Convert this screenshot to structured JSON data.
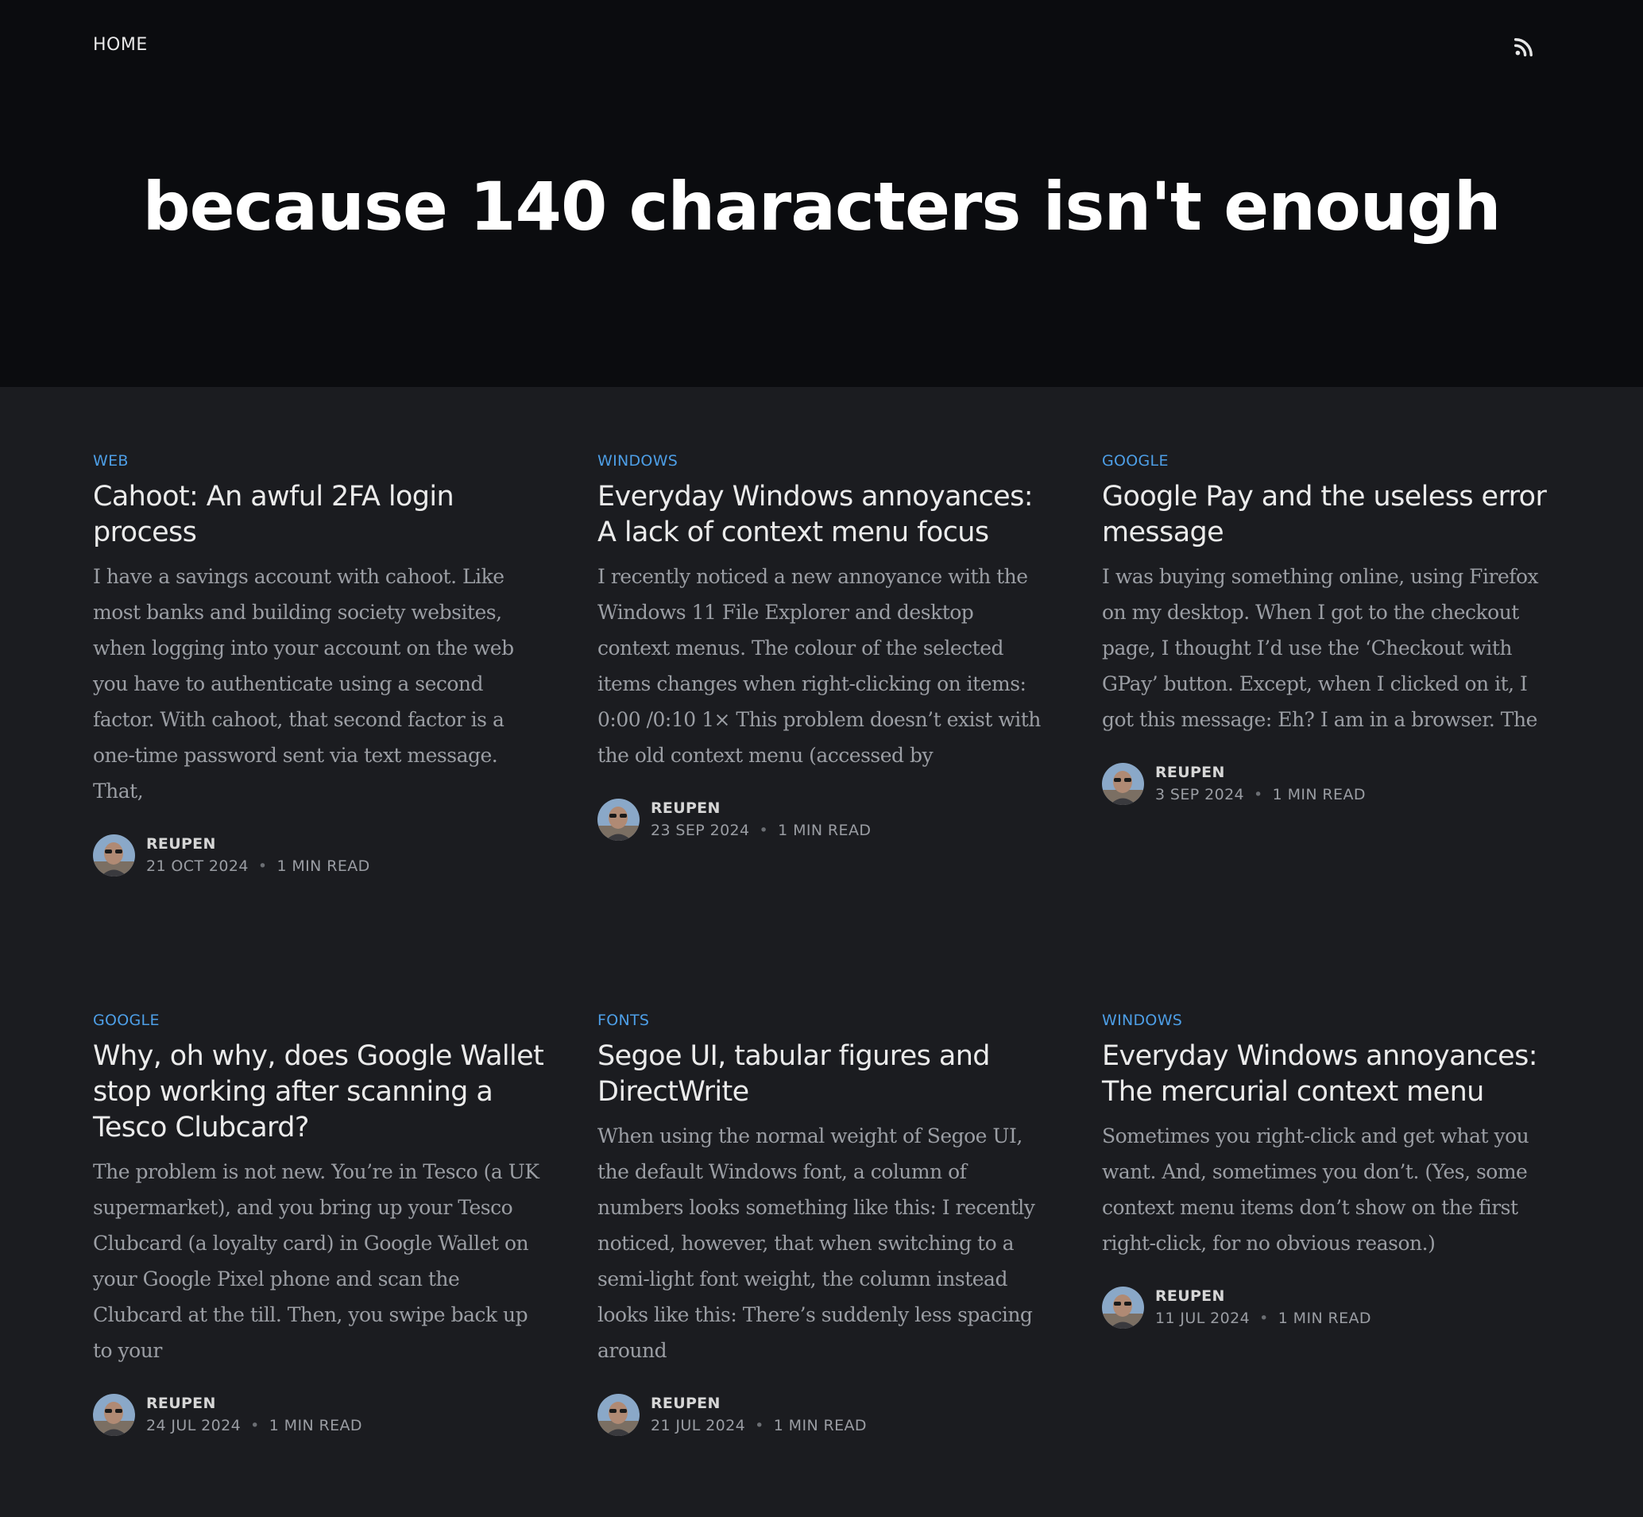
{
  "nav": {
    "home_label": "HOME"
  },
  "header": {
    "title": "because 140 characters isn't enough"
  },
  "posts": [
    {
      "tag": "WEB",
      "title": "Cahoot: An awful 2FA login process",
      "excerpt": "I have a savings account with cahoot. Like most banks and building society websites, when logging into your account on the web you have to authenticate using a second factor. With cahoot, that second factor is a one-time password sent via text message. That,",
      "author": "REUPEN",
      "date": "21 OCT 2024",
      "read_time": "1 MIN READ"
    },
    {
      "tag": "WINDOWS",
      "title": "Everyday Windows annoyances: A lack of context menu focus",
      "excerpt": "I recently noticed a new annoyance with the Windows 11 File Explorer and desktop context menus. The colour of the selected items changes when right-clicking on items: 0:00 /0:10 1× This problem doesn’t exist with the old context menu (accessed by",
      "author": "REUPEN",
      "date": "23 SEP 2024",
      "read_time": "1 MIN READ"
    },
    {
      "tag": "GOOGLE",
      "title": "Google Pay and the useless error message",
      "excerpt": "I was buying something online, using Firefox on my desktop. When I got to the checkout page, I thought I’d use the ‘Checkout with GPay’ button. Except, when I clicked on it, I got this message: Eh? I am in a browser. The",
      "author": "REUPEN",
      "date": "3 SEP 2024",
      "read_time": "1 MIN READ"
    },
    {
      "tag": "GOOGLE",
      "title": "Why, oh why, does Google Wallet stop working after scanning a Tesco Clubcard?",
      "excerpt": "The problem is not new. You’re in Tesco (a UK supermarket), and you bring up your Tesco Clubcard (a loyalty card) in Google Wallet on your Google Pixel phone and scan the Clubcard at the till. Then, you swipe back up to your",
      "author": "REUPEN",
      "date": "24 JUL 2024",
      "read_time": "1 MIN READ"
    },
    {
      "tag": "FONTS",
      "title": "Segoe UI, tabular figures and DirectWrite",
      "excerpt": "When using the normal weight of Segoe UI, the default Windows font, a column of numbers looks something like this: I recently noticed, however, that when switching to a semi-light font weight, the column instead looks like this: There’s suddenly less spacing around",
      "author": "REUPEN",
      "date": "21 JUL 2024",
      "read_time": "1 MIN READ"
    },
    {
      "tag": "WINDOWS",
      "title": "Everyday Windows annoyances: The mercurial context menu",
      "excerpt": "Sometimes you right-click and get what you want. And, sometimes you don’t. (Yes, some context menu items don’t show on the first right-click, for no obvious reason.)",
      "author": "REUPEN",
      "date": "11 JUL 2024",
      "read_time": "1 MIN READ"
    }
  ]
}
